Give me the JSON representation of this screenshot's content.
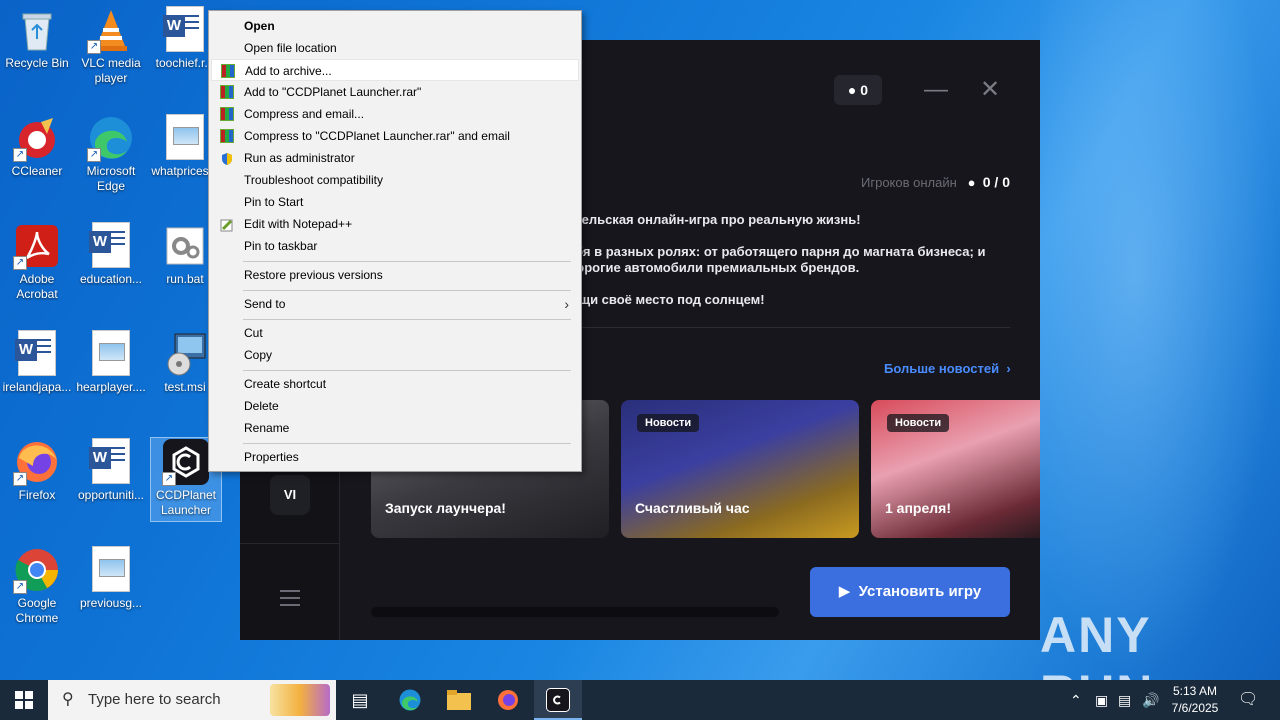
{
  "desktop": {
    "icons": [
      {
        "label": "Recycle Bin"
      },
      {
        "label": "VLC media player"
      },
      {
        "label": "toochief.r..."
      },
      {
        "label": "CCleaner"
      },
      {
        "label": "Microsoft Edge"
      },
      {
        "label": "whatprices..."
      },
      {
        "label": "Adobe Acrobat"
      },
      {
        "label": "education..."
      },
      {
        "label": "run.bat"
      },
      {
        "label": "irelandjapa..."
      },
      {
        "label": "hearplayer...."
      },
      {
        "label": "test.msi"
      },
      {
        "label": "Firefox"
      },
      {
        "label": "opportuniti..."
      },
      {
        "label": "CCDPlanet Launcher"
      },
      {
        "label": "Google Chrome"
      },
      {
        "label": "previousg..."
      }
    ]
  },
  "launcher": {
    "online_count": "0",
    "online_label": "Игроков онлайн",
    "online_value": "0 / 0",
    "description": [
      "ательская онлайн-игра про реальную жизнь!",
      "ебя в разных ролях: от работящего парня до магната бизнеса; и дорогие автомобили премиальных брендов.",
      "ыщи своё место под солнцем!"
    ],
    "more_news": "Больше новостей",
    "cards": [
      {
        "tag": "",
        "title": "Запуск лаунчера!"
      },
      {
        "tag": "Новости",
        "title": "Счастливый час"
      },
      {
        "tag": "Новости",
        "title": "1 апреля!"
      }
    ],
    "vi_badge": "VI",
    "install_button": "Установить игру",
    "progress": 0
  },
  "context_menu": {
    "items": [
      {
        "label": "Open",
        "icon": "",
        "bold": true
      },
      {
        "label": "Open file location",
        "icon": ""
      },
      {
        "label": "Add to archive...",
        "icon": "winrar-icon",
        "highlighted": true
      },
      {
        "label": "Add to \"CCDPlanet Launcher.rar\"",
        "icon": "winrar-icon"
      },
      {
        "label": "Compress and email...",
        "icon": "winrar-icon"
      },
      {
        "label": "Compress to \"CCDPlanet Launcher.rar\" and email",
        "icon": "winrar-icon"
      },
      {
        "label": "Run as administrator",
        "icon": "shield-icon"
      },
      {
        "label": "Troubleshoot compatibility",
        "icon": ""
      },
      {
        "label": "Pin to Start",
        "icon": ""
      },
      {
        "label": "Edit with Notepad++",
        "icon": "notepadpp-icon"
      },
      {
        "label": "Pin to taskbar",
        "icon": ""
      },
      {
        "label": "Restore previous versions",
        "icon": ""
      },
      {
        "label": "Send to",
        "icon": "",
        "submenu": true
      },
      {
        "label": "Cut",
        "icon": ""
      },
      {
        "label": "Copy",
        "icon": ""
      },
      {
        "label": "Create shortcut",
        "icon": ""
      },
      {
        "label": "Delete",
        "icon": ""
      },
      {
        "label": "Rename",
        "icon": ""
      },
      {
        "label": "Properties",
        "icon": ""
      }
    ]
  },
  "taskbar": {
    "search_placeholder": "Type here to search",
    "time": "5:13 AM",
    "date": "7/6/2025"
  },
  "watermark": "ANY RUN"
}
